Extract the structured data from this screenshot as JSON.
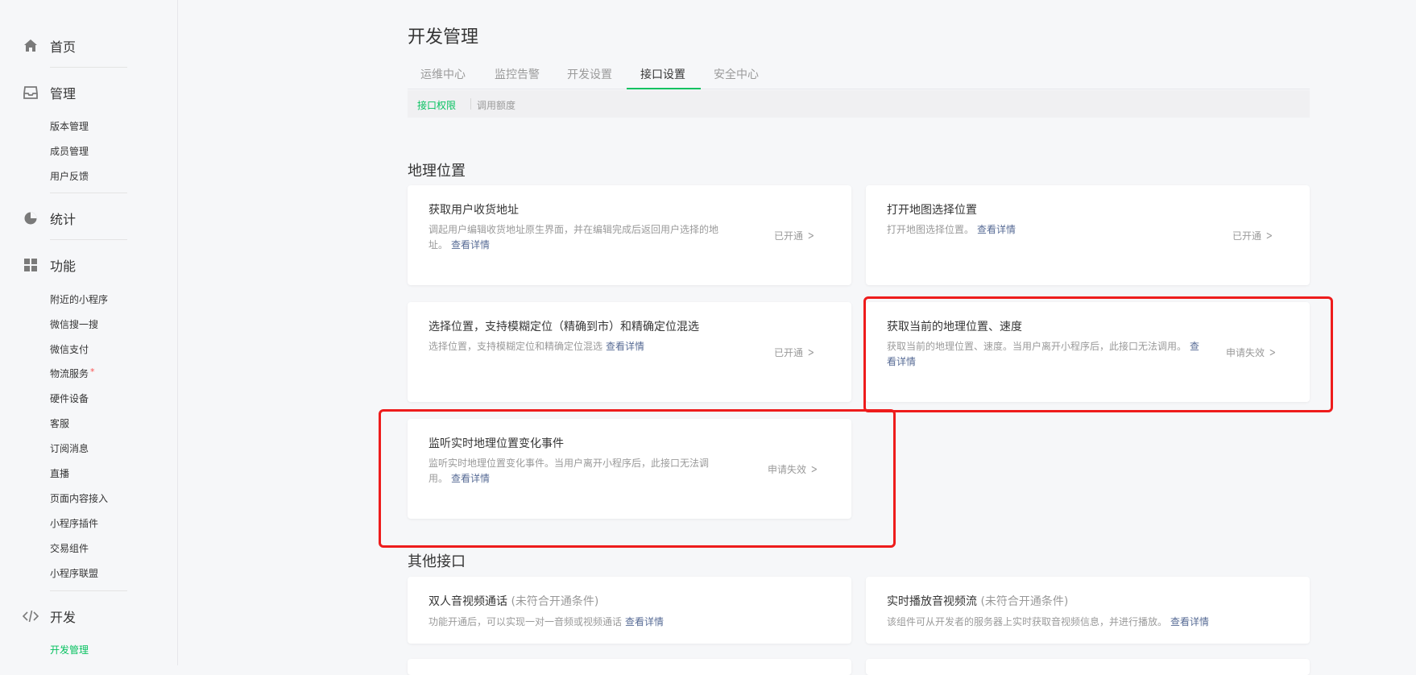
{
  "sidebar": {
    "home": "首页",
    "manage": {
      "label": "管理",
      "items": [
        "版本管理",
        "成员管理",
        "用户反馈"
      ]
    },
    "stats": "统计",
    "features": {
      "label": "功能",
      "items": [
        "附近的小程序",
        "微信搜一搜",
        "微信支付",
        "物流服务",
        "硬件设备",
        "客服",
        "订阅消息",
        "直播",
        "页面内容接入",
        "小程序插件",
        "交易组件",
        "小程序联盟"
      ],
      "badge_marker": "*"
    },
    "dev": {
      "label": "开发",
      "items": [
        "开发管理"
      ]
    }
  },
  "main": {
    "title": "开发管理",
    "tabs": [
      "运维中心",
      "监控告警",
      "开发设置",
      "接口设置",
      "安全中心"
    ],
    "active_tab": "接口设置",
    "subtabs": [
      "接口权限",
      "调用额度"
    ],
    "active_subtab": "接口权限"
  },
  "sections": {
    "geo": {
      "title": "地理位置",
      "cards": [
        {
          "title": "获取用户收货地址",
          "desc": "调起用户编辑收货地址原生界面，并在编辑完成后返回用户选择的地址。",
          "link": "查看详情",
          "status": "已开通"
        },
        {
          "title": "打开地图选择位置",
          "desc": "打开地图选择位置。",
          "link": "查看详情",
          "status": "已开通"
        },
        {
          "title": "选择位置，支持模糊定位（精确到市）和精确定位混选",
          "desc": "选择位置，支持模糊定位和精确定位混选",
          "link": "查看详情",
          "status": "已开通"
        },
        {
          "title": "获取当前的地理位置、速度",
          "desc": "获取当前的地理位置、速度。当用户离开小程序后，此接口无法调用。",
          "link": "查看详情",
          "status": "申请失效"
        },
        {
          "title": "监听实时地理位置变化事件",
          "desc": "监听实时地理位置变化事件。当用户离开小程序后，此接口无法调用。",
          "link": "查看详情",
          "status": "申请失效"
        }
      ]
    },
    "other": {
      "title": "其他接口",
      "cards": [
        {
          "title": "双人音视频通话",
          "note": "(未符合开通条件)",
          "desc": "功能开通后，可以实现一对一音频或视频通话",
          "link": "查看详情"
        },
        {
          "title": "实时播放音视频流",
          "note": "(未符合开通条件)",
          "desc": "该组件可从开发者的服务器上实时获取音视频信息，并进行播放。",
          "link": "查看详情"
        }
      ]
    }
  },
  "colors": {
    "accent": "#07c160",
    "link": "#576b95",
    "highlight": "#ee1c1c",
    "muted": "#9a9a9a"
  }
}
